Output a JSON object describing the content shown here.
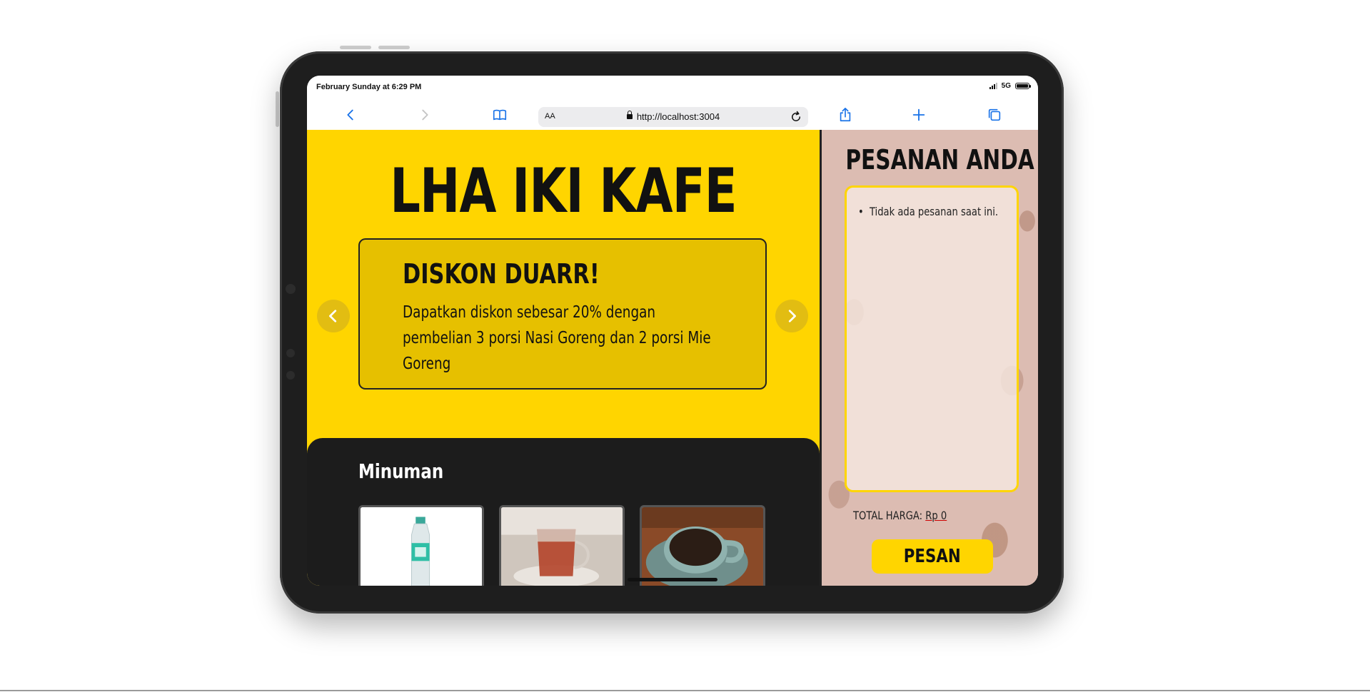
{
  "status_bar": {
    "time": "February Sunday at 6:29 PM",
    "network": "5G"
  },
  "browser": {
    "text_size_label": "AA",
    "url": "http://localhost:3004",
    "icons": {
      "back": "chevron-left-icon",
      "forward": "chevron-right-icon",
      "bookmarks": "book-icon",
      "reload": "reload-icon",
      "share": "share-icon",
      "new_tab": "plus-icon",
      "tabs": "tabs-icon"
    },
    "accent": "#1a73e8"
  },
  "hero": {
    "title": "LHA IKI KAFE",
    "promo_title": "DISKON DUARR!",
    "promo_text": "Dapatkan diskon sebesar 20% dengan pembelian 3 porsi Nasi Goreng dan 2 porsi Mie Goreng"
  },
  "menu": {
    "section_title": "Minuman",
    "items": [
      {
        "image": "bottled-water"
      },
      {
        "image": "glass-of-tea"
      },
      {
        "image": "cup-of-coffee"
      }
    ]
  },
  "orders": {
    "title": "PESANAN ANDA",
    "empty_message": "Tidak ada pesanan saat ini.",
    "total_label": "TOTAL HARGA:",
    "total_value": "Rp 0",
    "order_button": "PESAN"
  },
  "colors": {
    "brand_yellow": "#ffd500",
    "dark_panel": "#1c1c1c",
    "side_bg": "#dcbcb2"
  }
}
